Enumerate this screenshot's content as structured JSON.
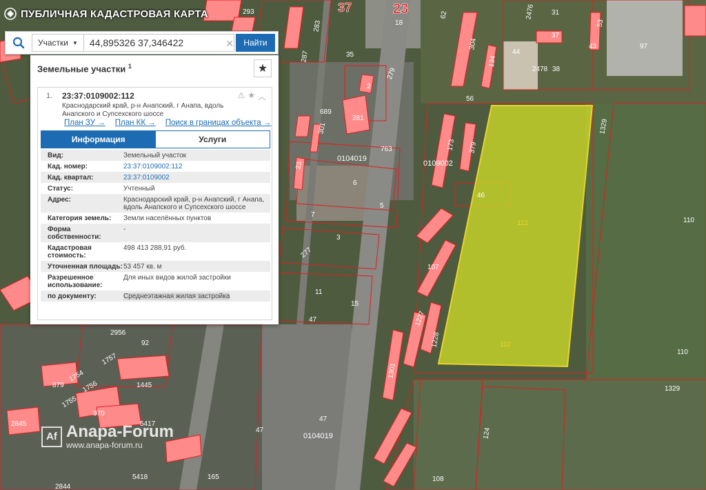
{
  "app": {
    "title": "ПУБЛИЧНАЯ КАДАСТРОВАЯ КАРТА"
  },
  "search": {
    "type_label": "Участки",
    "query": "44,895326 37,346422",
    "find_label": "Найти"
  },
  "panel": {
    "title": "Земельные участки",
    "count": "1",
    "result": {
      "number": "1.",
      "id": "23:37:0109002:112",
      "address": "Краснодарский край, р-н Анапский, г Анапа, вдоль Анапского и Супсехского шоссе",
      "links": [
        "План ЗУ →",
        "План КК →",
        "Поиск в границах объекта →"
      ],
      "tabs": [
        "Информация",
        "Услуги"
      ],
      "rows": [
        {
          "label": "Вид:",
          "value": "Земельный участок"
        },
        {
          "label": "Кад. номер:",
          "value": "23:37:0109002:112"
        },
        {
          "label": "Кад. квартал:",
          "value": "23:37:0109002"
        },
        {
          "label": "Статус:",
          "value": "Учтенный"
        },
        {
          "label": "Адрес:",
          "value": "Краснодарский край, р-н Анапский, г Анапа, вдоль Анапского и Супсехского шоссе"
        },
        {
          "label": "Категория земель:",
          "value": "Земли населённых пунктов"
        },
        {
          "label": "Форма собственности:",
          "value": "-"
        },
        {
          "label": "Кадастровая стоимость:",
          "value": "498 413 288,91 руб."
        },
        {
          "label": "Уточненная площадь:",
          "value": "53 457 кв. м"
        },
        {
          "label": "Разрешенное использование:",
          "value": "Для иных видов жилой застройки"
        },
        {
          "label": "по документу:",
          "value": "Среднеэтажная жилая застройка"
        }
      ]
    }
  },
  "map_labels": {
    "quarter_north": "37",
    "quarter_23": "23",
    "block_0104019": "0104019",
    "block_0109002": "0109002",
    "block_0104019_south": "0104019",
    "parcel_112_a": "112",
    "parcel_112_b": "112",
    "parcel_110_a": "110",
    "parcel_110_b": "110",
    "parcel_1329_a": "1329",
    "parcel_1329_b": "1329",
    "parcel_46": "46",
    "parcel_107": "107",
    "parcel_1227": "1227",
    "parcel_1228": "1228",
    "parcel_379": "379",
    "parcel_173": "173",
    "parcel_304": "304",
    "parcel_134": "134",
    "parcel_56": "56",
    "parcel_44": "44",
    "parcel_2476": "2476",
    "parcel_31": "31",
    "parcel_37": "37",
    "parcel_2478": "2478",
    "parcel_38": "38",
    "parcel_43": "43",
    "parcel_53": "53",
    "parcel_97": "97",
    "parcel_62": "62",
    "parcel_18": "18",
    "parcel_35": "35",
    "parcel_279": "279",
    "parcel_2": "2",
    "parcel_689": "689",
    "parcel_281": "281",
    "parcel_301": "301",
    "parcel_763": "763",
    "parcel_6": "6",
    "parcel_5": "5",
    "parcel_7": "7",
    "parcel_3": "3",
    "parcel_277": "277",
    "parcel_11": "11",
    "parcel_15": "15",
    "parcel_47_a": "47",
    "parcel_47_b": "47",
    "parcel_47_c": "47",
    "parcel_92": "92",
    "parcel_2956": "2956",
    "parcel_1757": "1757",
    "parcel_879": "879",
    "parcel_1754": "1754",
    "parcel_1756": "1756",
    "parcel_1755": "1755",
    "parcel_1445": "1445",
    "parcel_370": "370",
    "parcel_2845": "2845",
    "parcel_5417": "5417",
    "parcel_5418": "5418",
    "parcel_2844": "2844",
    "parcel_165": "165",
    "parcel_1301": "1301",
    "parcel_124": "124",
    "parcel_108": "108",
    "parcel_293": "293",
    "parcel_287": "287",
    "parcel_283": "283",
    "parcel_23": "23"
  },
  "watermark": {
    "logo": "Af",
    "title": "Anapa-Forum",
    "url": "www.anapa-forum.ru"
  },
  "colors": {
    "primary": "#1d6cb3",
    "parcel_fill": "#ff8a8a",
    "parcel_stroke": "#e01f1f",
    "selected_fill": "#c8d628",
    "imagery": "#4d5a3c"
  }
}
